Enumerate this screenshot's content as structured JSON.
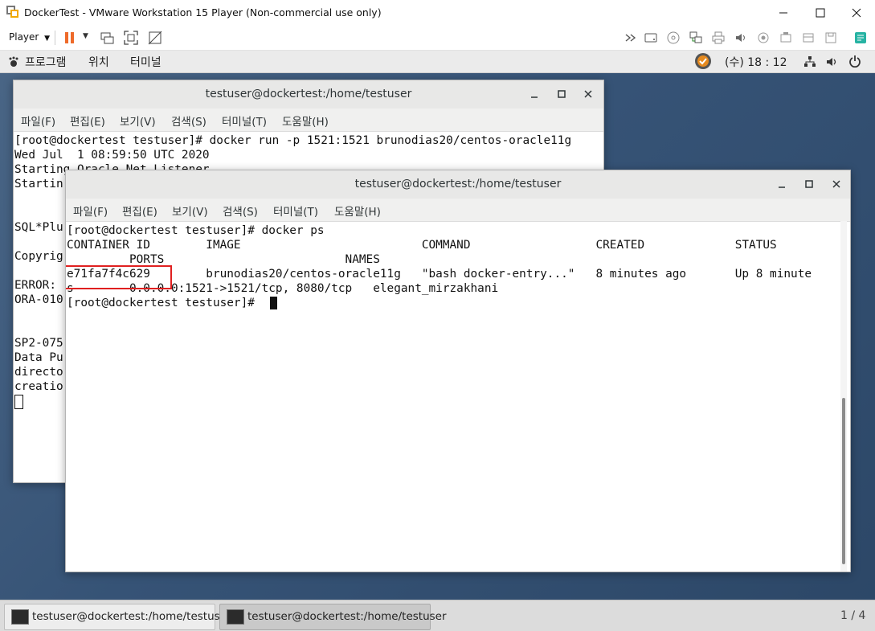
{
  "vmware": {
    "title": "DockerTest - VMware Workstation 15 Player (Non-commercial use only)",
    "player_menu": "Player"
  },
  "desktop": {
    "menu": {
      "programs": "프로그램",
      "places": "위치",
      "terminal": "터미널"
    },
    "clock": "(수) 18 : 12"
  },
  "term_back": {
    "title": "testuser@dockertest:/home/testuser",
    "menus": [
      "파일(F)",
      "편집(E)",
      "보기(V)",
      "검색(S)",
      "터미널(T)",
      "도움말(H)"
    ],
    "lines": [
      "[root@dockertest testuser]# docker run -p 1521:1521 brunodias20/centos-oracle11g",
      "Wed Jul  1 08:59:50 UTC 2020",
      "Starting Oracle Net Listener.",
      "Startin",
      "",
      "",
      "SQL*Plu",
      "",
      "Copyrig",
      "",
      "ERROR:",
      "ORA-010",
      "",
      "",
      "SP2-075",
      "Data Pu",
      "directo",
      "creatio"
    ]
  },
  "term_front": {
    "title": "testuser@dockertest:/home/testuser",
    "menus": [
      "파일(F)",
      "편집(E)",
      "보기(V)",
      "검색(S)",
      "터미널(T)",
      "도움말(H)"
    ],
    "lines": [
      "[root@dockertest testuser]# docker ps",
      "CONTAINER ID        IMAGE                          COMMAND                  CREATED             STATUS",
      "         PORTS                          NAMES",
      "e71fa7f4c629        brunodias20/centos-oracle11g   \"bash docker-entry...\"   8 minutes ago       Up 8 minute",
      "s        0.0.0.0:1521->1521/tcp, 8080/tcp   elegant_mirzakhani",
      "[root@dockertest testuser]# "
    ],
    "highlighted_container_id": "e71fa7f4c629"
  },
  "taskbar": {
    "items": [
      "testuser@dockertest:/home/testuser",
      "testuser@dockertest:/home/testuser"
    ],
    "workspace": "1 / 4"
  },
  "colors": {
    "highlight_box": "#e02020",
    "desktop_bg": "#3a5677"
  }
}
